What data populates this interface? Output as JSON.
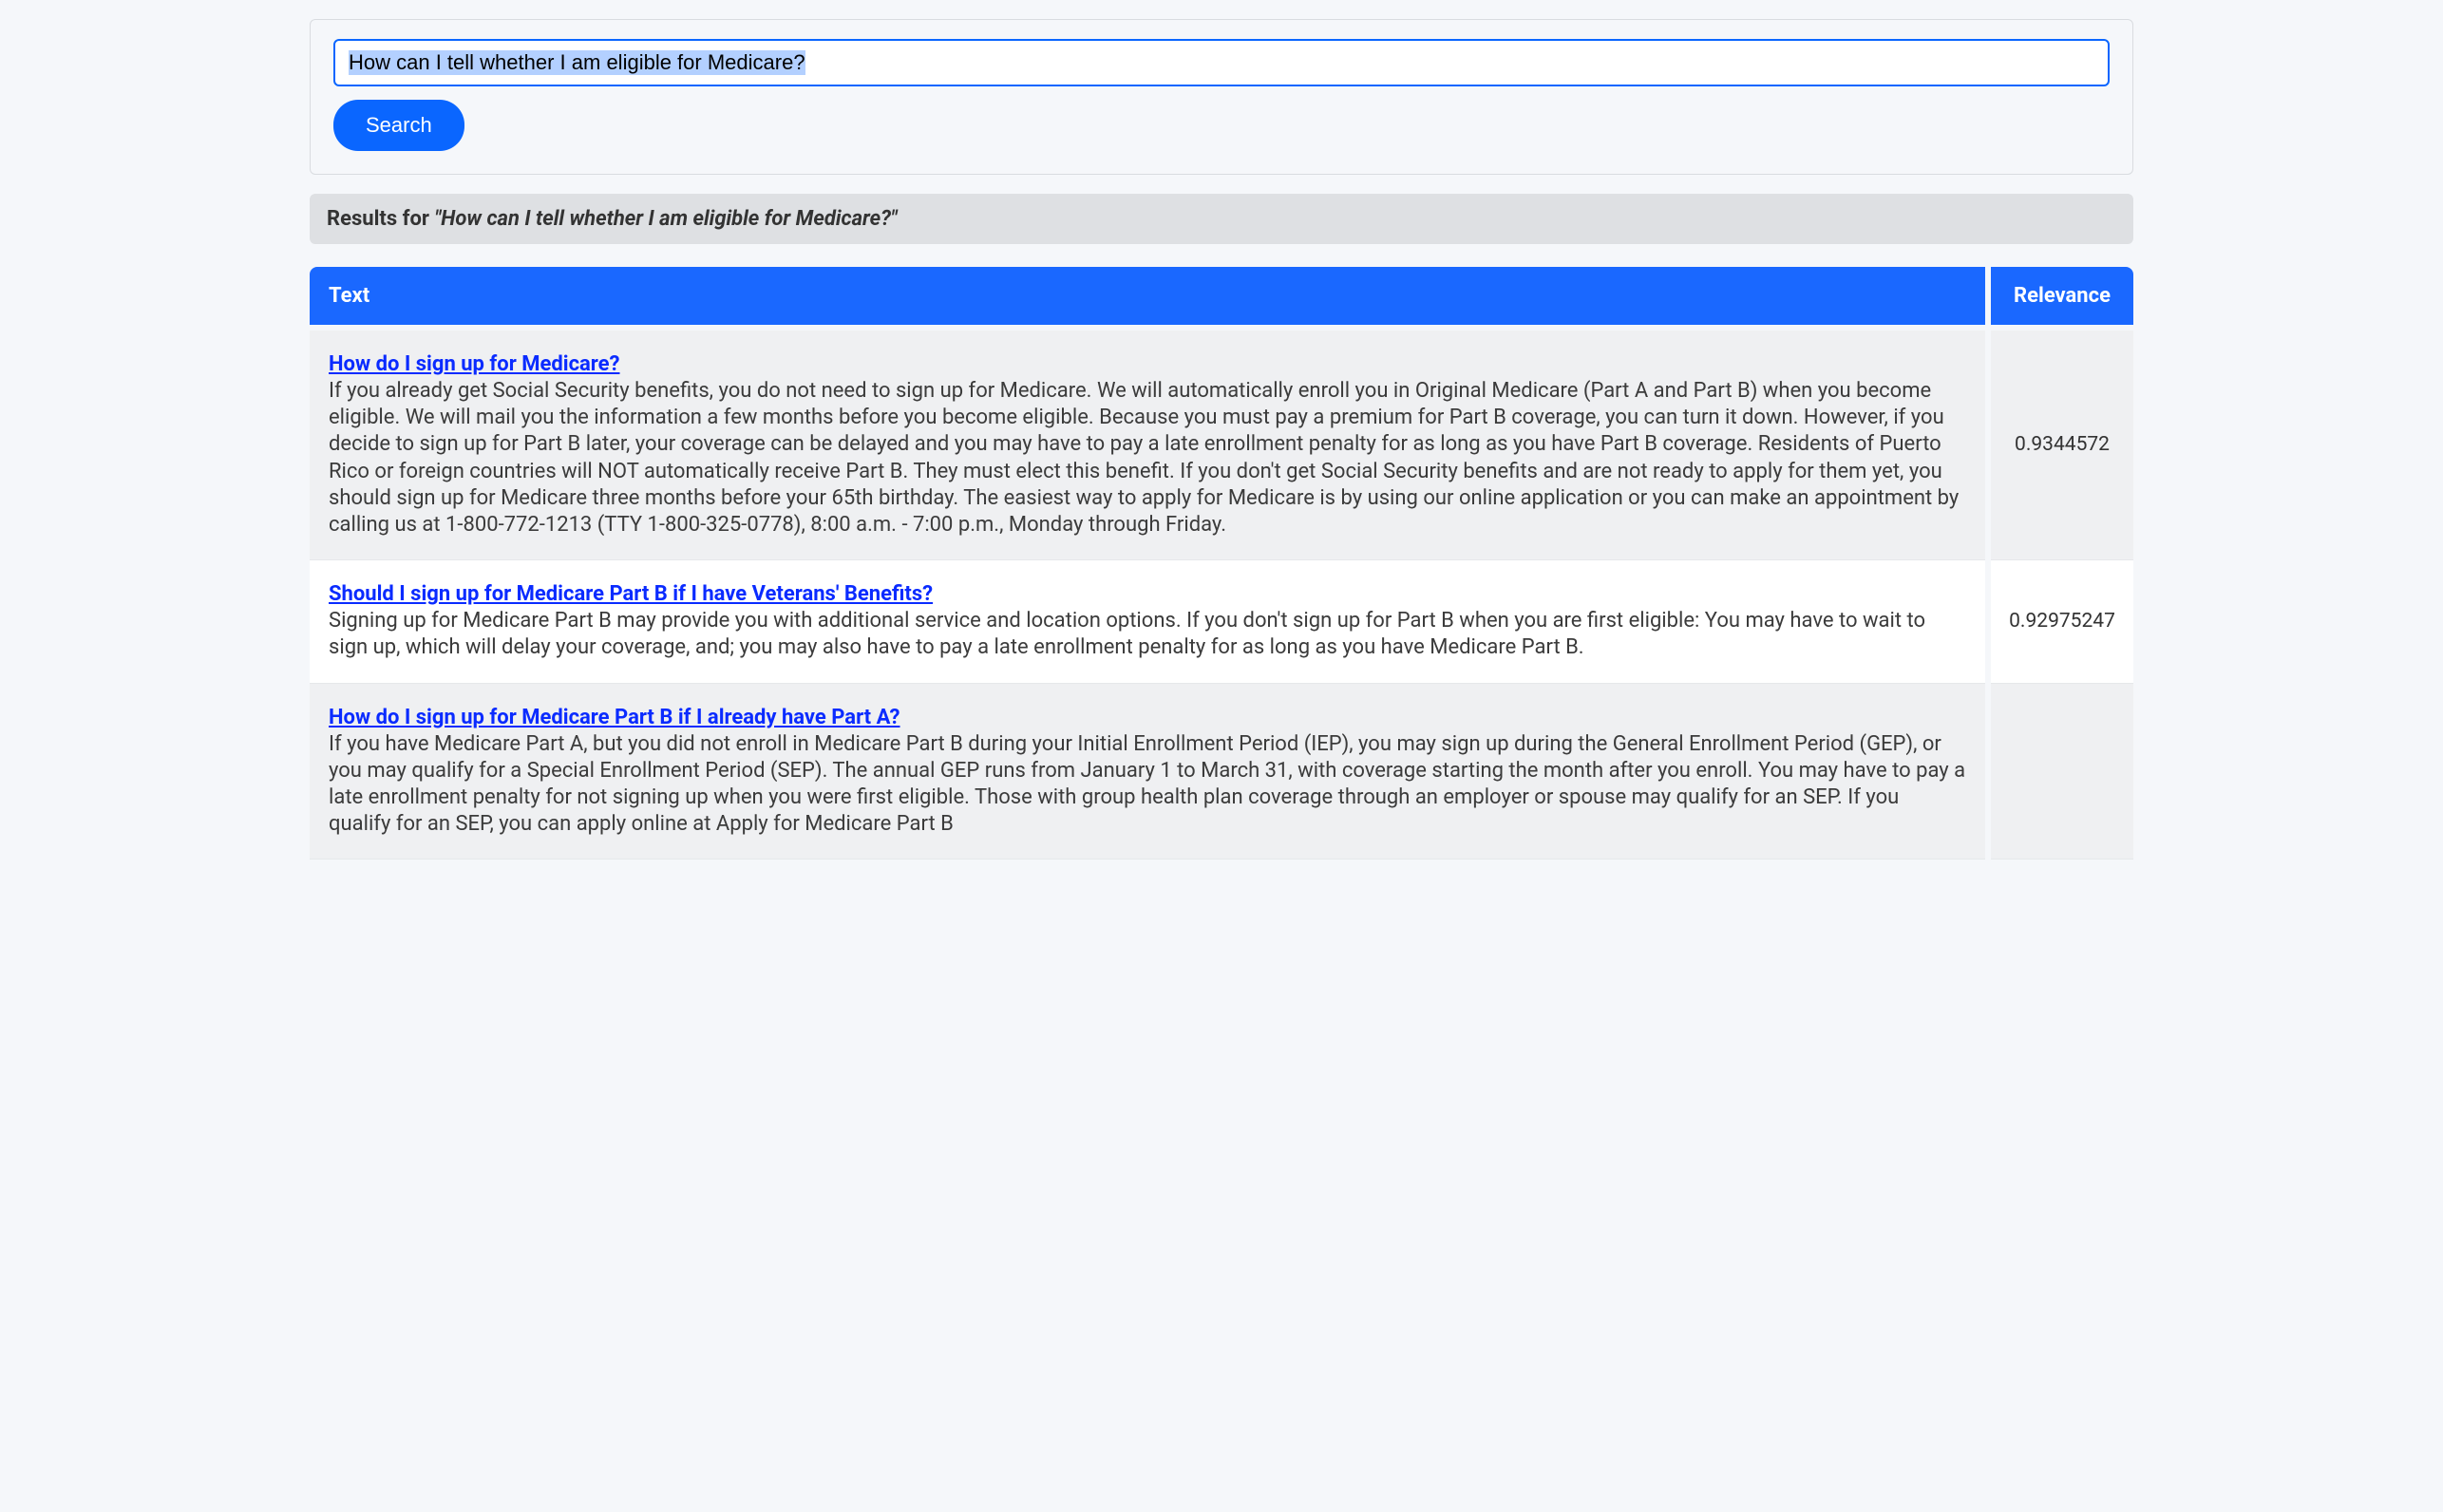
{
  "search": {
    "value": "How can I tell whether I am eligible for Medicare?",
    "button_label": "Search"
  },
  "results_header": {
    "prefix": "Results for ",
    "query": "\"How can I tell whether I am eligible for Medicare?\""
  },
  "table": {
    "columns": {
      "text": "Text",
      "relevance": "Relevance"
    },
    "rows": [
      {
        "title": "How do I sign up for Medicare?",
        "body": "If you already get Social Security benefits, you do not need to sign up for Medicare. We will automatically enroll you in Original Medicare (Part A and Part B) when you become eligible. We will mail you the information a few months before you become eligible. Because you must pay a premium for Part B coverage, you can turn it down. However, if you decide to sign up for Part B later, your coverage can be delayed and you may have to pay a late enrollment penalty for as long as you have Part B coverage. Residents of Puerto Rico or foreign countries will NOT automatically receive Part B. They must elect this benefit. If you don't get Social Security benefits and are not ready to apply for them yet, you should sign up for Medicare three months before your 65th birthday. The easiest way to apply for Medicare is by using our online application or you can make an appointment by calling us at 1-800-772-1213 (TTY 1-800-325-0778), 8:00 a.m. - 7:00 p.m., Monday through Friday.",
        "relevance": "0.9344572"
      },
      {
        "title": "Should I sign up for Medicare Part B if I have Veterans' Benefits?",
        "body": "Signing up for Medicare Part B may provide you with additional service and location options. If you don't sign up for Part B when you are first eligible: You may have to wait to sign up, which will delay your coverage, and; you may also have to pay a late enrollment penalty for as long as you have Medicare Part B.",
        "relevance": "0.92975247"
      },
      {
        "title": "How do I sign up for Medicare Part B if I already have Part A?",
        "body": "If you have Medicare Part A, but you did not enroll in Medicare Part B during your Initial Enrollment Period (IEP), you may sign up during the General Enrollment Period (GEP), or you may qualify for a Special Enrollment Period (SEP). The annual GEP runs from January 1 to March 31, with coverage starting the month after you enroll. You may have to pay a late enrollment penalty for not signing up when you were first eligible. Those with group health plan coverage through an employer or spouse may qualify for an SEP. If you qualify for an SEP, you can apply online at Apply for Medicare Part B",
        "relevance": ""
      }
    ]
  }
}
